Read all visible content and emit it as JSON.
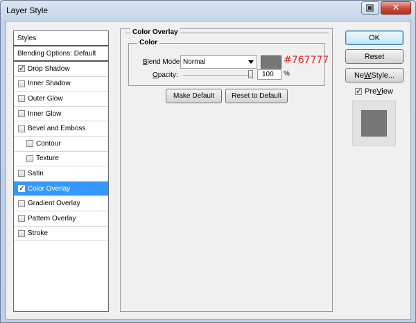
{
  "window": {
    "title": "Layer Style"
  },
  "titlebar": {
    "close_glyph": "✕"
  },
  "styles_panel": {
    "header": "Styles",
    "blending_options": "Blending Options: Default",
    "items": [
      {
        "label": "Drop Shadow",
        "checked": true,
        "indent": false,
        "selected": false
      },
      {
        "label": "Inner Shadow",
        "checked": false,
        "indent": false,
        "selected": false
      },
      {
        "label": "Outer Glow",
        "checked": false,
        "indent": false,
        "selected": false
      },
      {
        "label": "Inner Glow",
        "checked": false,
        "indent": false,
        "selected": false
      },
      {
        "label": "Bevel and Emboss",
        "checked": false,
        "indent": false,
        "selected": false
      },
      {
        "label": "Contour",
        "checked": false,
        "indent": true,
        "selected": false
      },
      {
        "label": "Texture",
        "checked": false,
        "indent": true,
        "selected": false
      },
      {
        "label": "Satin",
        "checked": false,
        "indent": false,
        "selected": false
      },
      {
        "label": "Color Overlay",
        "checked": true,
        "indent": false,
        "selected": true
      },
      {
        "label": "Gradient Overlay",
        "checked": false,
        "indent": false,
        "selected": false
      },
      {
        "label": "Pattern Overlay",
        "checked": false,
        "indent": false,
        "selected": false
      },
      {
        "label": "Stroke",
        "checked": false,
        "indent": false,
        "selected": false
      }
    ]
  },
  "overlay": {
    "section_title": "Color Overlay",
    "group_title": "Color",
    "blend_mode_label_underlined": "B",
    "blend_mode_label_rest": "lend Mode:",
    "blend_mode_value": "Normal",
    "swatch_color": "#767777",
    "hex_annotation": "#767777",
    "opacity_label_underlined": "O",
    "opacity_label_rest": "pacity:",
    "opacity_value": "100",
    "opacity_unit": "%",
    "make_default": "Make Default",
    "reset_to_default": "Reset to Default"
  },
  "actions": {
    "ok": "OK",
    "reset": "Reset",
    "new_style_underlined": "W",
    "new_style_prefix": "Ne",
    "new_style_suffix": " Style...",
    "preview_underlined": "V",
    "preview_prefix": "Pre",
    "preview_suffix": "iew",
    "preview_checked": true
  },
  "colors": {
    "selection": "#3399ff",
    "hex_annotation": "#e02020",
    "overlay_color": "#767777"
  }
}
